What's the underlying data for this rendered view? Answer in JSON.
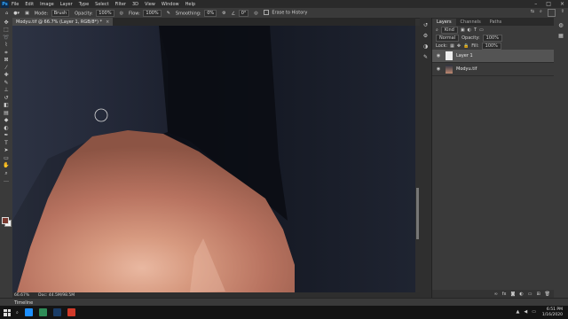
{
  "menubar": {
    "logo": "Ps",
    "items": [
      "File",
      "Edit",
      "Image",
      "Layer",
      "Type",
      "Select",
      "Filter",
      "3D",
      "View",
      "Window",
      "Help"
    ]
  },
  "options": {
    "mode_label": "Mode:",
    "mode_value": "Brush",
    "opacity_label": "Opacity:",
    "opacity_value": "100%",
    "flow_label": "Flow:",
    "flow_value": "100%",
    "smoothing_label": "Smoothing:",
    "smoothing_value": "0%",
    "angle_value": "0°",
    "erase_label": "Erase to History"
  },
  "document": {
    "tab_title": "Modyu.tif @ 66.7% (Layer 1, RGB/8*) *",
    "zoom": "66.67%",
    "doc_size": "Doc: 44.5M/98.5M"
  },
  "timeline": {
    "label": "Timeline"
  },
  "layers_panel": {
    "tabs": [
      "Layers",
      "Channels",
      "Paths"
    ],
    "kind_label": "Kind",
    "blend_mode": "Normal",
    "opacity_label": "Opacity:",
    "opacity_value": "100%",
    "lock_label": "Lock:",
    "fill_label": "Fill:",
    "fill_value": "100%",
    "layers": [
      {
        "name": "Layer 1",
        "selected": true
      },
      {
        "name": "Modyu.tif",
        "selected": false
      }
    ]
  },
  "taskbar": {
    "time": "6:51 PM",
    "date": "1/16/2020",
    "apps": [
      "#1e90ff",
      "#2e8b57",
      "#1a3c66",
      "#d03a2a"
    ]
  },
  "colors": {
    "accent": "#31a8ff",
    "foreground_swatch": "#7a3a30",
    "background_swatch": "#f3f3f3"
  }
}
